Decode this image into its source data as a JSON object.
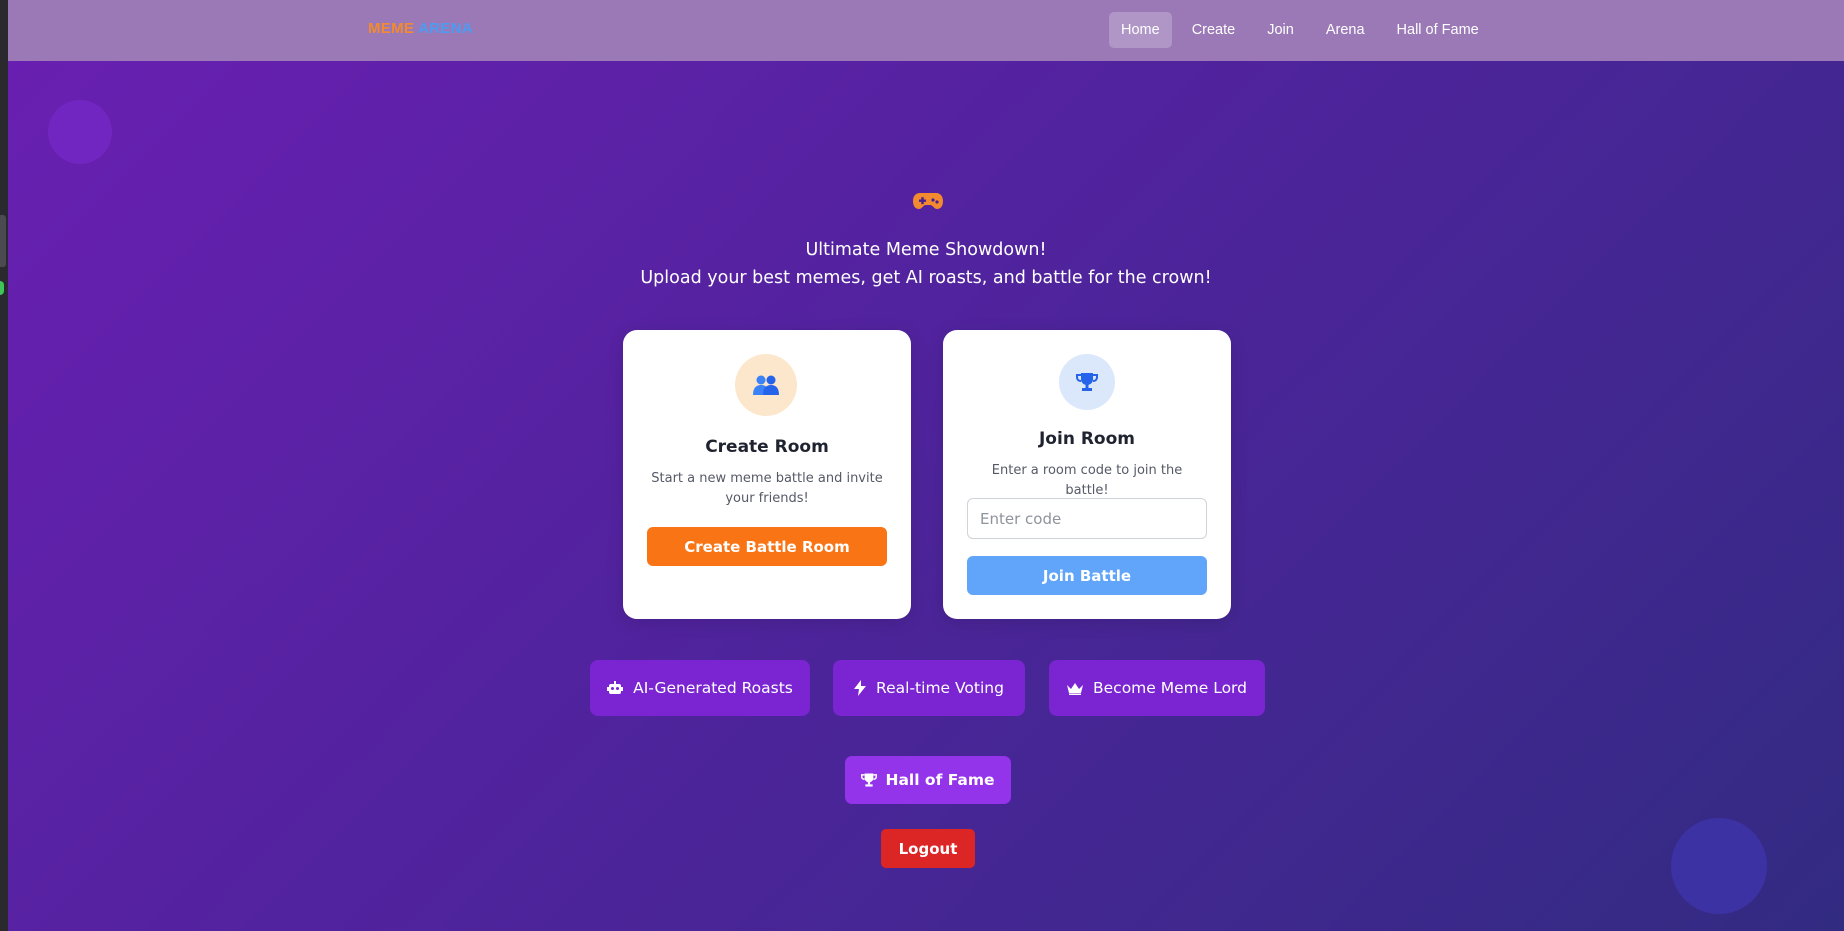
{
  "brand": {
    "word1": "MEME",
    "word2": "ARENA"
  },
  "nav": {
    "items": [
      "Home",
      "Create",
      "Join",
      "Arena",
      "Hall of Fame"
    ],
    "active": "Home"
  },
  "hero": {
    "icon": "gamepad-icon",
    "line1": "Ultimate Meme Showdown!",
    "line2": "Upload your best memes, get AI roasts, and battle for the crown!"
  },
  "create_card": {
    "icon": "people-icon",
    "title": "Create Room",
    "description": "Start a new meme battle and invite your friends!",
    "button": "Create Battle Room"
  },
  "join_card": {
    "icon": "trophy-icon",
    "title": "Join Room",
    "description": "Enter a room code to join the battle!",
    "input_value": "",
    "input_placeholder": "Enter code",
    "button": "Join Battle"
  },
  "features": [
    {
      "icon": "robot-icon",
      "label": "AI-Generated Roasts"
    },
    {
      "icon": "lightning-icon",
      "label": "Real-time Voting"
    },
    {
      "icon": "crown-icon",
      "label": "Become Meme Lord"
    }
  ],
  "hall_of_fame_button": "Hall of Fame",
  "logout_button": "Logout",
  "colors": {
    "brand_orange": "#f38a2f",
    "brand_blue": "#4b9cf2",
    "create_button": "#f97415",
    "join_button": "#60a5fa",
    "feature_bg": "#7a25d1",
    "hall_button": "#9333ea",
    "logout": "#dc2626"
  }
}
